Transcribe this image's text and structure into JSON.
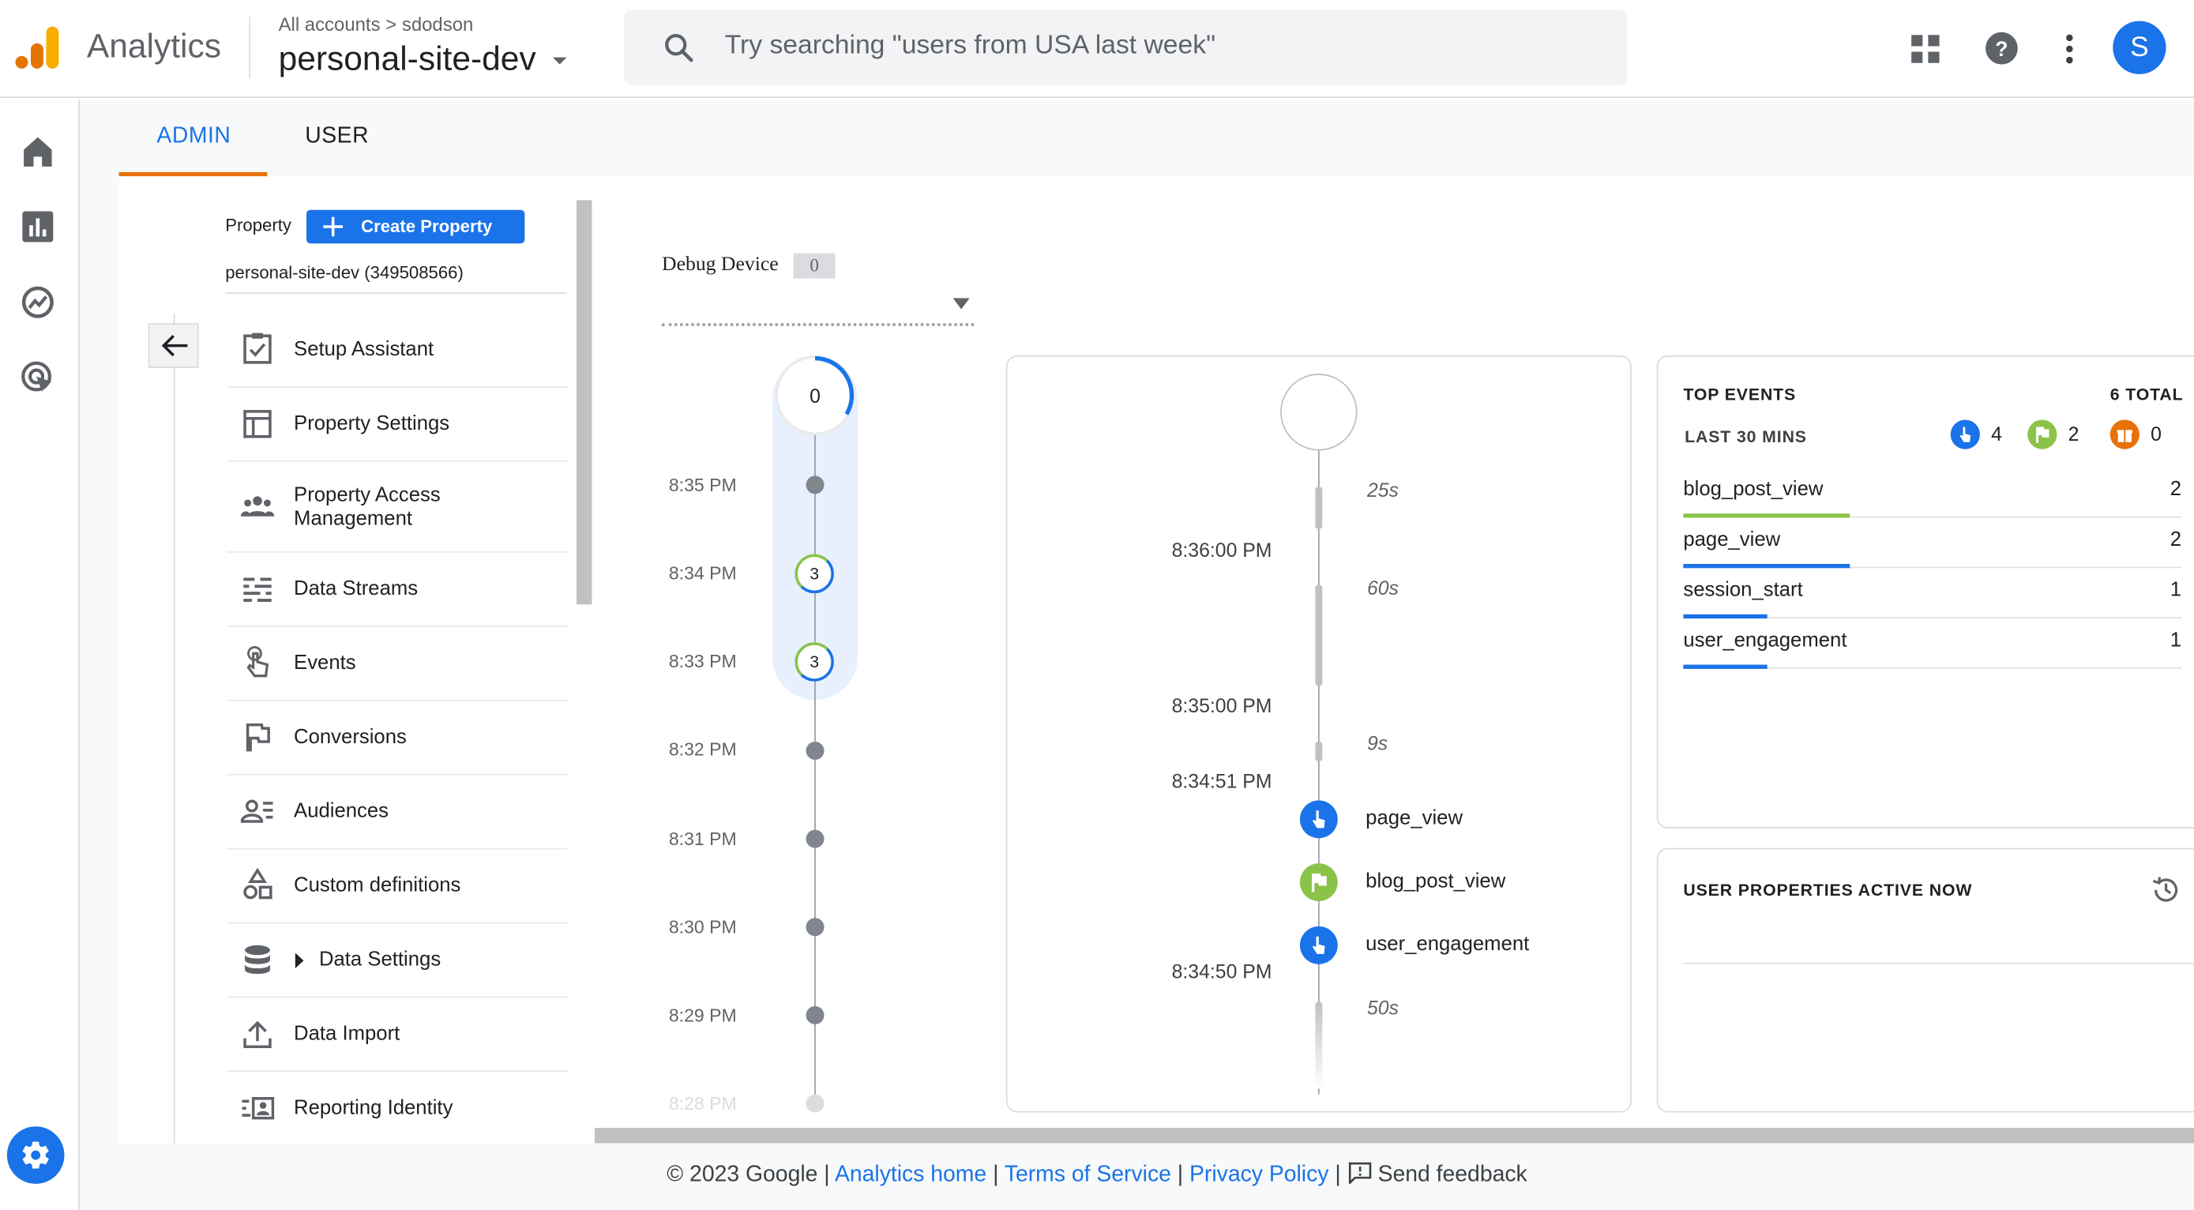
{
  "header": {
    "app_name": "Analytics",
    "breadcrumb_accounts": "All accounts",
    "breadcrumb_separator": ">",
    "breadcrumb_account": "sdodson",
    "property_name": "personal-site-dev",
    "search_placeholder": "Try searching \"users from USA last week\"",
    "avatar_letter": "S"
  },
  "tabs": [
    {
      "label": "ADMIN",
      "active": true
    },
    {
      "label": "USER",
      "active": false
    }
  ],
  "property_column": {
    "label": "Property",
    "create_button": "Create Property",
    "property_id_text": "personal-site-dev (349508566)"
  },
  "nav_items": [
    {
      "label": "Setup Assistant",
      "icon": "checklist-icon"
    },
    {
      "label": "Property Settings",
      "icon": "settings-layout-icon"
    },
    {
      "label": "Property Access Management",
      "icon": "people-icon"
    },
    {
      "label": "Data Streams",
      "icon": "streams-icon"
    },
    {
      "label": "Events",
      "icon": "touch-icon"
    },
    {
      "label": "Conversions",
      "icon": "flag-icon"
    },
    {
      "label": "Audiences",
      "icon": "audience-icon"
    },
    {
      "label": "Custom definitions",
      "icon": "shapes-icon"
    },
    {
      "label": "Data Settings",
      "icon": "database-icon"
    },
    {
      "label": "Data Import",
      "icon": "upload-icon"
    },
    {
      "label": "Reporting Identity",
      "icon": "identity-icon"
    }
  ],
  "debug": {
    "label": "Debug Device",
    "count": "0",
    "top_count": "0",
    "times": [
      "8:35 PM",
      "8:34 PM",
      "8:33 PM",
      "8:32 PM",
      "8:31 PM",
      "8:30 PM",
      "8:29 PM",
      "8:28 PM"
    ],
    "minute_counts": [
      "3",
      "3"
    ]
  },
  "seconds_stream": {
    "times": [
      "8:36:00 PM",
      "8:35:00 PM",
      "8:34:51 PM",
      "8:34:50 PM"
    ],
    "durations": [
      "25s",
      "60s",
      "9s",
      "50s"
    ],
    "events": [
      {
        "name": "page_view",
        "type": "touch",
        "color": "#1a73e8"
      },
      {
        "name": "blog_post_view",
        "type": "flag",
        "color": "#8bc34a"
      },
      {
        "name": "user_engagement",
        "type": "touch",
        "color": "#1a73e8"
      }
    ]
  },
  "top_events": {
    "title": "TOP EVENTS",
    "total": "6 TOTAL",
    "period": "LAST 30 MINS",
    "counters": [
      {
        "icon": "touch-icon",
        "color": "#1a73e8",
        "count": "4"
      },
      {
        "icon": "flag-icon",
        "color": "#8bc34a",
        "count": "2"
      },
      {
        "icon": "gift-icon",
        "color": "#e8710a",
        "count": "0"
      }
    ],
    "rows": [
      {
        "name": "blog_post_view",
        "count": "2",
        "bar_color": "#8bc34a",
        "share": 0.33
      },
      {
        "name": "page_view",
        "count": "2",
        "bar_color": "#1a73e8",
        "share": 0.33
      },
      {
        "name": "session_start",
        "count": "1",
        "bar_color": "#1a73e8",
        "share": 0.17
      },
      {
        "name": "user_engagement",
        "count": "1",
        "bar_color": "#1a73e8",
        "share": 0.17
      }
    ]
  },
  "user_properties": {
    "title": "USER PROPERTIES ACTIVE NOW"
  },
  "footer": {
    "copyright": "© 2023 Google |",
    "analytics_home": "Analytics home",
    "sep1": "|",
    "terms": "Terms of Service",
    "sep2": "|",
    "privacy": "Privacy Policy",
    "sep3": "|",
    "feedback": "Send feedback"
  }
}
